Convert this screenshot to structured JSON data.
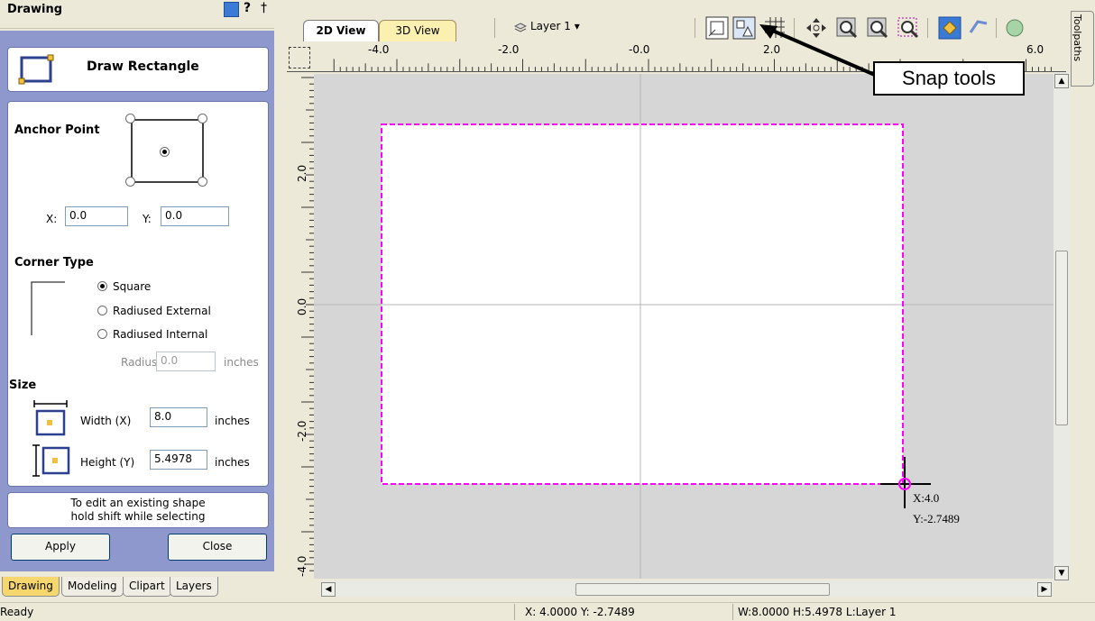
{
  "panel": {
    "title": "Drawing",
    "help_label": "?",
    "tool_title": "Draw Rectangle",
    "anchor_label": "Anchor Point",
    "x_label": "X:",
    "x_value": "0.0",
    "y_label": "Y:",
    "y_value": "0.0",
    "corner_type_label": "Corner Type",
    "corner_options": [
      "Square",
      "Radiused External",
      "Radiused Internal"
    ],
    "corner_selected": "Square",
    "radius_label": "Radius",
    "radius_value": "0.0",
    "radius_unit": "inches",
    "size_label": "Size",
    "width_label": "Width (X)",
    "width_value": "8.0",
    "width_unit": "inches",
    "height_label": "Height (Y)",
    "height_value": "5.4978",
    "height_unit": "inches",
    "hint_line1": "To edit an existing shape",
    "hint_line2": "hold shift while selecting",
    "apply_label": "Apply",
    "close_label": "Close"
  },
  "bottom_tabs": [
    "Drawing",
    "Modeling",
    "Clipart",
    "Layers"
  ],
  "view_tabs": [
    "2D View",
    "3D View"
  ],
  "layer_select": "Layer 1",
  "side_tab": "Toolpaths",
  "ruler": {
    "h_labels": [
      "-4.0",
      "-2.0",
      "-0.0",
      "2.0",
      "6.0"
    ],
    "v_labels": [
      "2.0",
      "0.0",
      "-2.0",
      "-4.0"
    ]
  },
  "callout": "Snap tools",
  "cursor": {
    "x": "X:4.0",
    "y": "Y:-2.7489"
  },
  "status": {
    "ready": "Ready",
    "position": "X: 4.0000 Y: -2.7489",
    "size": "W:8.0000  H:5.4978 L:Layer 1"
  },
  "colors": {
    "panel_bg": "#8f98cc",
    "rect_outline": "#ff00ff",
    "active_tab": "#f5d76e"
  }
}
